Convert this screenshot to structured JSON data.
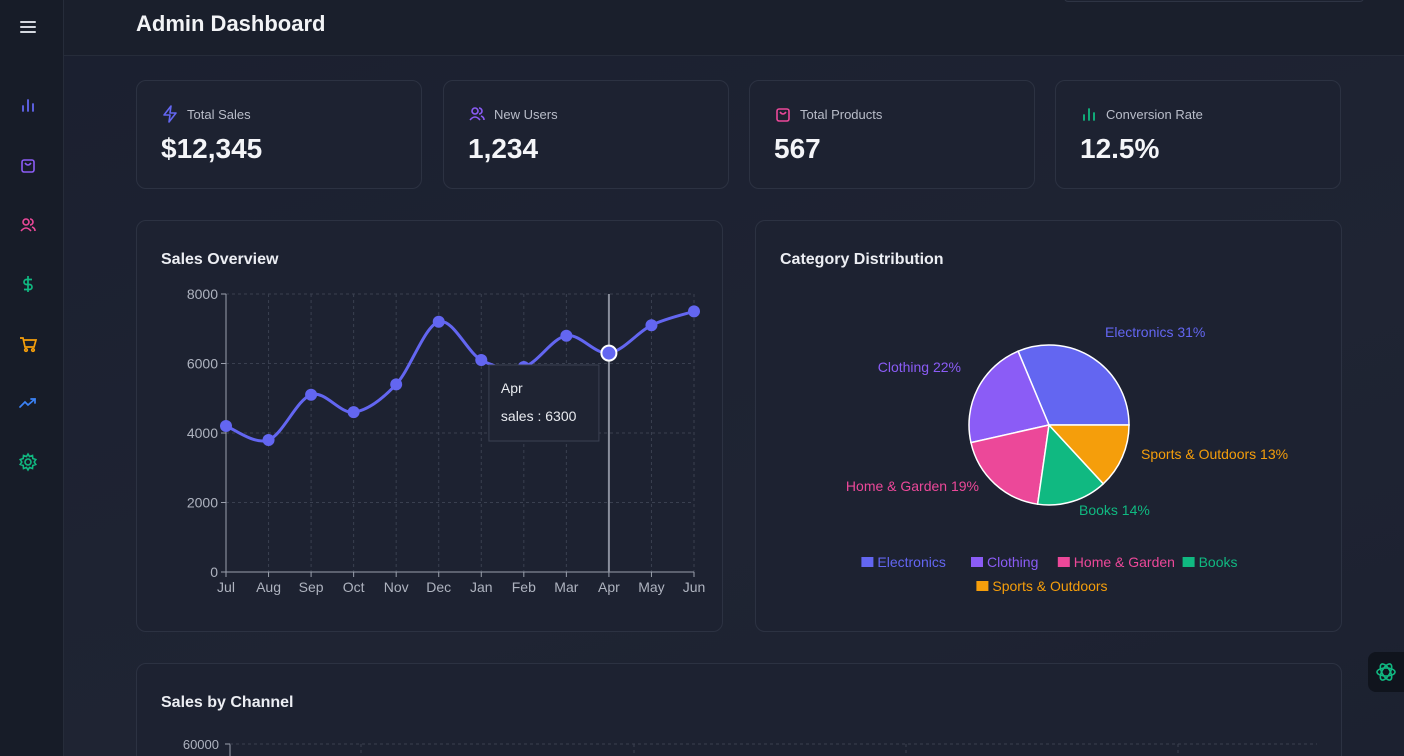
{
  "app": {
    "title": "Admin Dashboard"
  },
  "sidebar": {
    "items": [
      {
        "icon": "menu-icon",
        "color": "#d4d7df"
      },
      {
        "icon": "bar-chart-icon",
        "color": "#6366f1"
      },
      {
        "icon": "shopping-bag-icon",
        "color": "#8b5cf6"
      },
      {
        "icon": "users-icon",
        "color": "#ec4899"
      },
      {
        "icon": "dollar-icon",
        "color": "#10b981"
      },
      {
        "icon": "cart-icon",
        "color": "#f59e0b"
      },
      {
        "icon": "trending-up-icon",
        "color": "#3b82f6"
      },
      {
        "icon": "settings-icon",
        "color": "#10b981"
      }
    ]
  },
  "stats": [
    {
      "label": "Total Sales",
      "value": "$12,345",
      "icon": "zap-icon",
      "color": "#6366f1"
    },
    {
      "label": "New Users",
      "value": "1,234",
      "icon": "users-icon",
      "color": "#8b5cf6"
    },
    {
      "label": "Total Products",
      "value": "567",
      "icon": "shopping-bag-icon",
      "color": "#ec4899"
    },
    {
      "label": "Conversion Rate",
      "value": "12.5%",
      "icon": "bar-chart-icon",
      "color": "#10b981"
    }
  ],
  "sales_overview": {
    "title": "Sales Overview"
  },
  "category_distribution": {
    "title": "Category Distribution"
  },
  "sales_by_channel": {
    "title": "Sales by Channel",
    "y_top_tick": "60000"
  },
  "tooltip": {
    "month": "Apr",
    "text": "sales : 6300"
  },
  "chart_data": [
    {
      "type": "line",
      "title": "Sales Overview",
      "x": [
        "Jul",
        "Aug",
        "Sep",
        "Oct",
        "Nov",
        "Dec",
        "Jan",
        "Feb",
        "Mar",
        "Apr",
        "May",
        "Jun"
      ],
      "series": [
        {
          "name": "sales",
          "values": [
            4200,
            3800,
            5100,
            4600,
            5400,
            7200,
            6100,
            5900,
            6800,
            6300,
            7100,
            7500
          ],
          "color": "#6366f1"
        }
      ],
      "ylim": [
        0,
        8000
      ],
      "yticks": [
        0,
        2000,
        4000,
        6000,
        8000
      ],
      "grid": true,
      "highlight_index": 9
    },
    {
      "type": "pie",
      "title": "Category Distribution",
      "labels": [
        "Electronics",
        "Clothing",
        "Home & Garden",
        "Books",
        "Sports & Outdoors"
      ],
      "values": [
        31,
        22,
        19,
        14,
        13
      ],
      "data_labels": [
        "Electronics 31%",
        "Clothing 22%",
        "Home & Garden 19%",
        "Books 14%",
        "Sports & Outdoors 13%"
      ],
      "colors": [
        "#6366f1",
        "#8b5cf6",
        "#ec4899",
        "#10b981",
        "#f59e0b"
      ],
      "legend": "bottom"
    }
  ]
}
